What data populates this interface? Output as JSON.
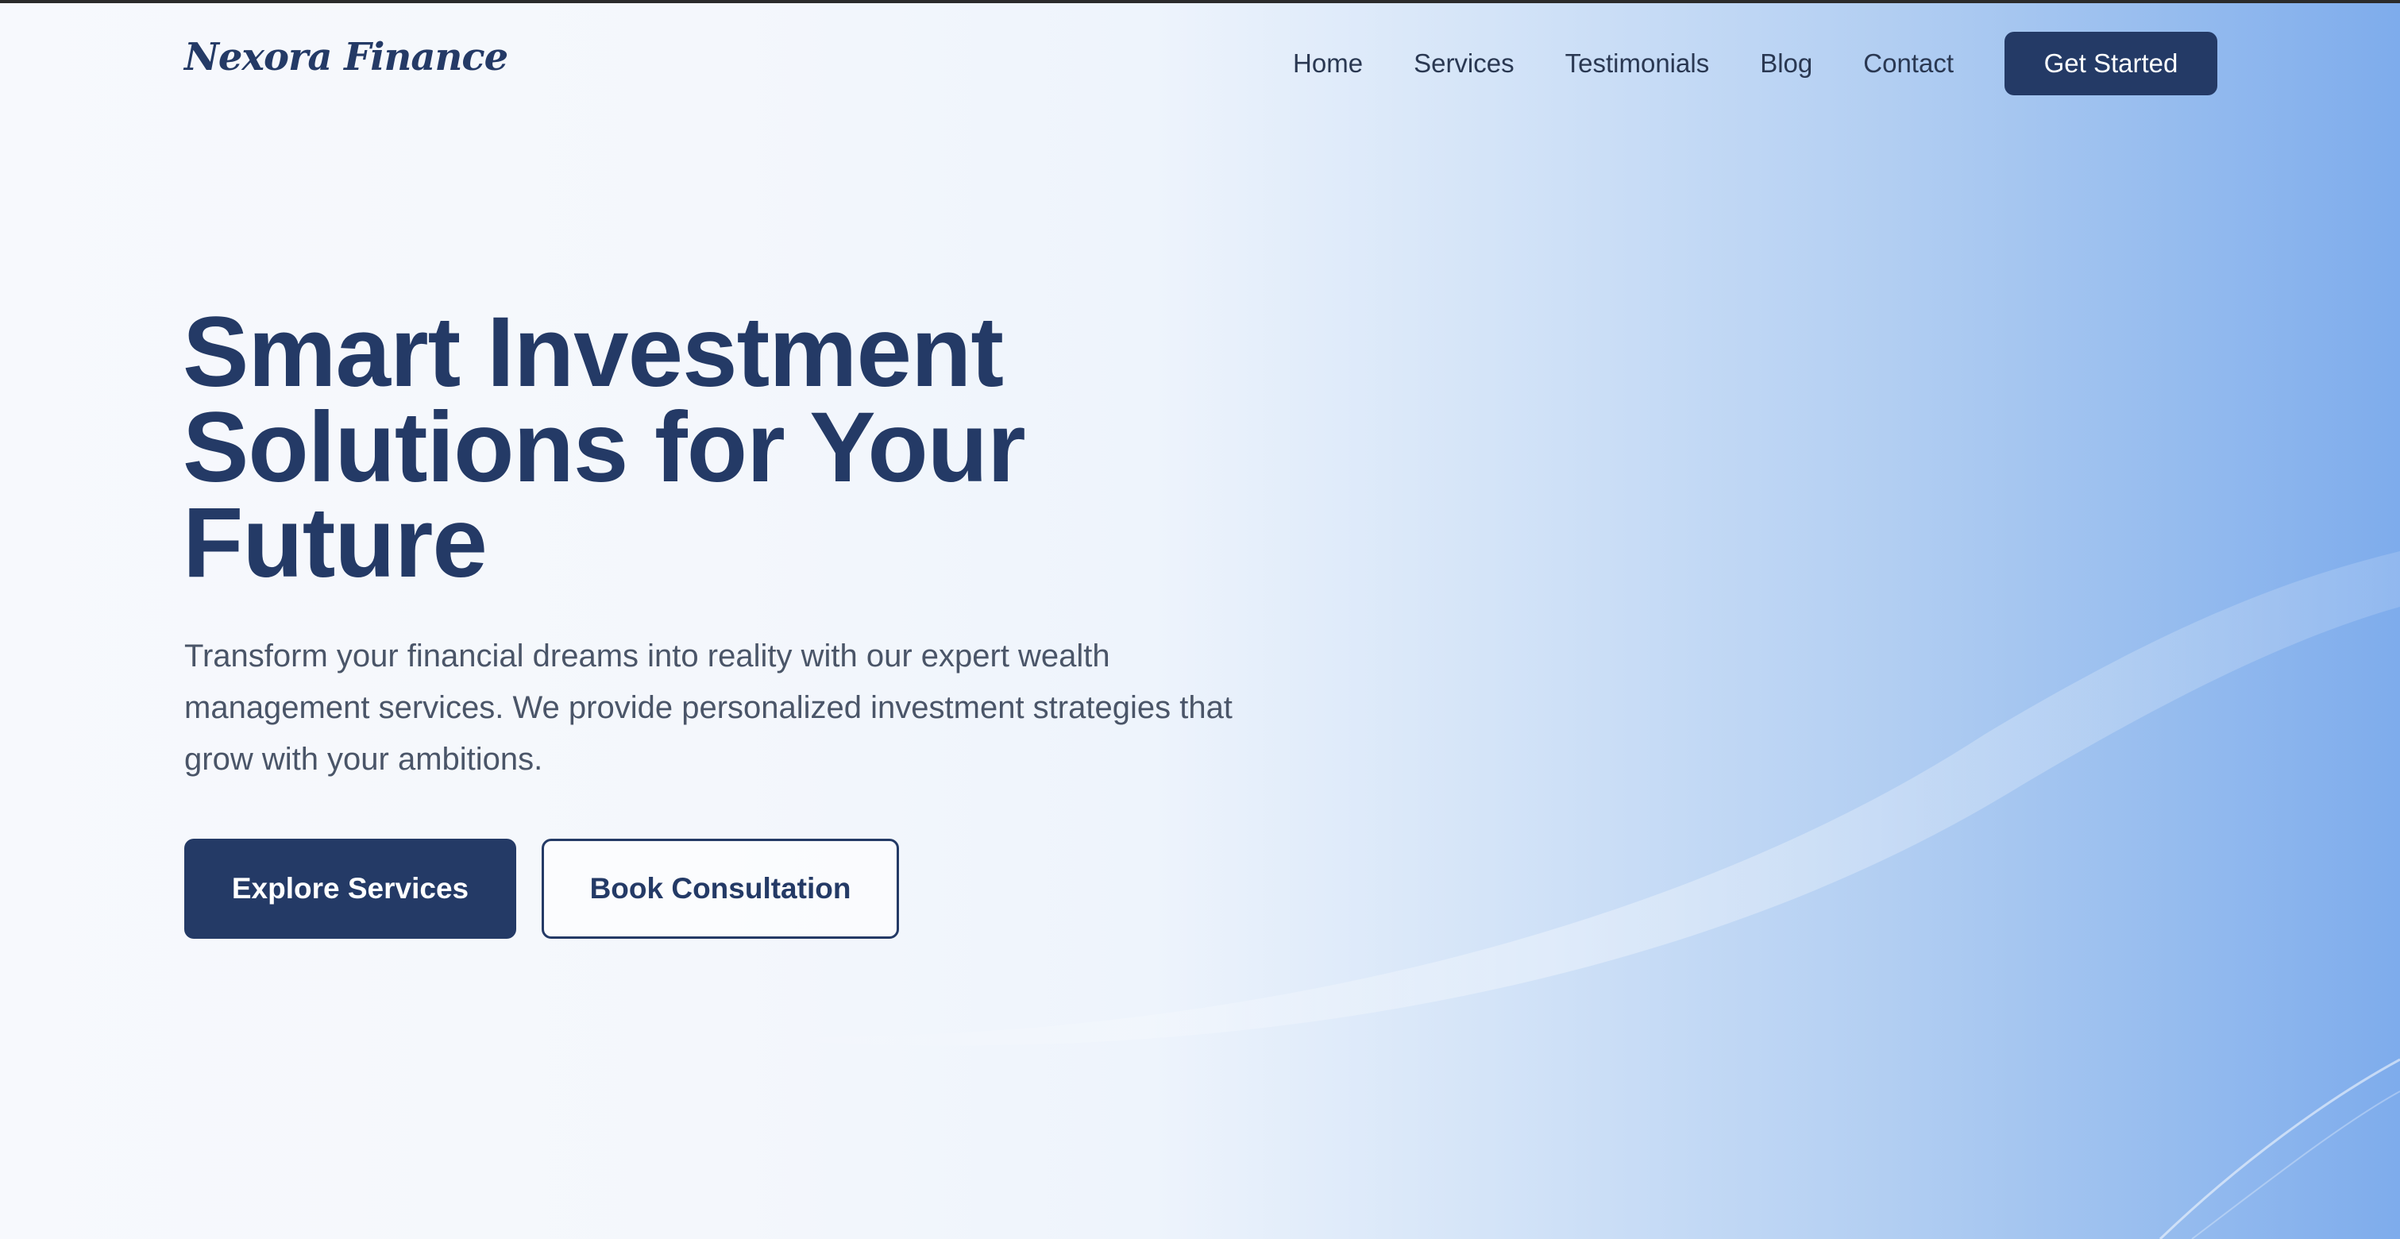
{
  "brand": {
    "logo_text": "Nexora Finance"
  },
  "nav": {
    "items": [
      {
        "label": "Home"
      },
      {
        "label": "Services"
      },
      {
        "label": "Testimonials"
      },
      {
        "label": "Blog"
      },
      {
        "label": "Contact"
      }
    ],
    "cta_label": "Get Started"
  },
  "hero": {
    "title": "Smart Investment Solutions for Your Future",
    "subtitle": "Transform your financial dreams into reality with our expert wealth management services. We provide personalized investment strategies that grow with your ambitions.",
    "primary_button": "Explore Services",
    "secondary_button": "Book Consultation"
  },
  "colors": {
    "brand_navy": "#243a66",
    "body_text": "#4a5568",
    "gradient_light": "#f4f7fc",
    "gradient_blue": "#7eacec"
  }
}
